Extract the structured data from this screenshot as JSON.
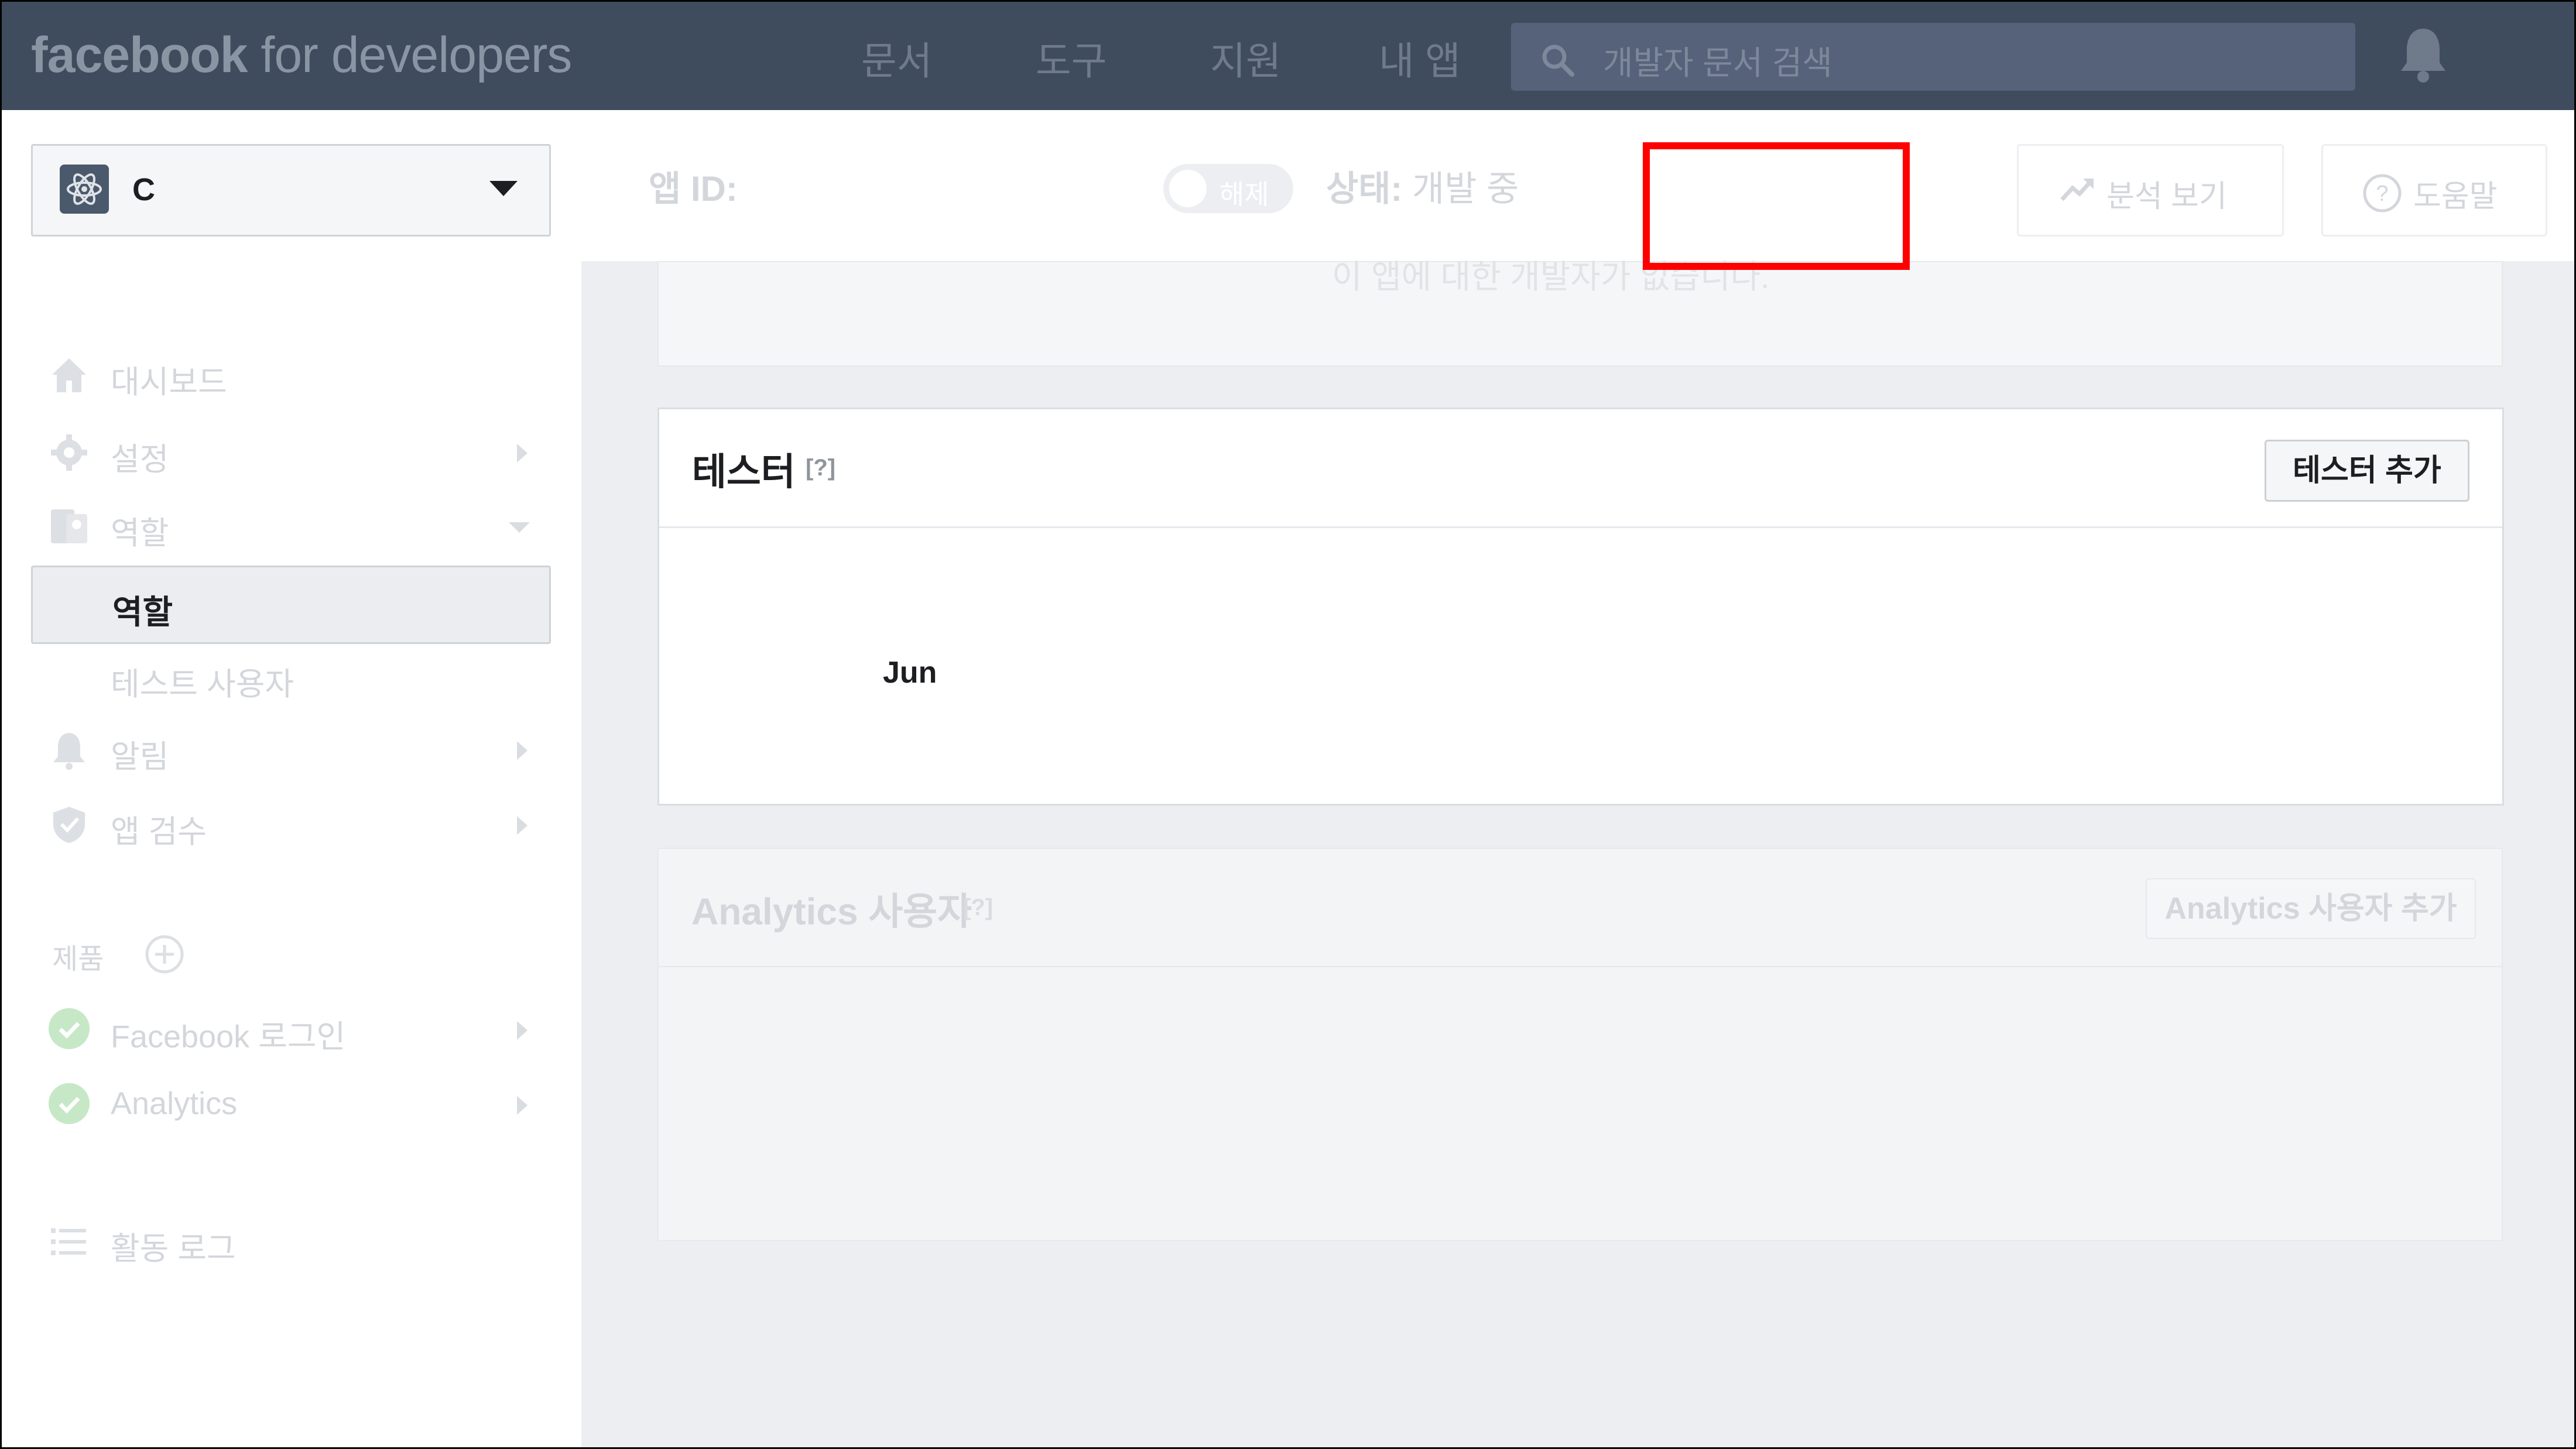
{
  "topbar": {
    "logo_bold": "facebook",
    "logo_rest": " for developers",
    "nav": [
      "문서",
      "도구",
      "지원",
      "내 앱"
    ],
    "search_placeholder": "개발자 문서 검색"
  },
  "appbar": {
    "app_name": "C",
    "app_id_label": "앱 ID:",
    "toggle_label": "해제",
    "status_label": "상태:",
    "status_value": " 개발 중",
    "analytics_button": "분석 보기",
    "help_button": "도움말"
  },
  "sidebar": {
    "items": {
      "dashboard": "대시보드",
      "settings": "설정",
      "roles": "역할",
      "roles_sub_active": "역할",
      "test_users": "테스트 사용자",
      "alerts": "알림",
      "app_review": "앱 검수",
      "products_header": "제품",
      "facebook_login": "Facebook 로그인",
      "analytics": "Analytics",
      "activity_log": "활동 로그"
    }
  },
  "main": {
    "top_card_text": "이 앱에 대한 개발자가 없습니다.",
    "testers": {
      "title": "테스터",
      "help": "[?]",
      "add_button": "테스터 추가",
      "users": [
        "Jun"
      ]
    },
    "analytics_users": {
      "title": "Analytics 사용자",
      "help": "[?]",
      "add_button": "Analytics 사용자 추가"
    }
  },
  "colors": {
    "topbar_bg": "#3f4c5e",
    "highlight": "#ff0000"
  }
}
